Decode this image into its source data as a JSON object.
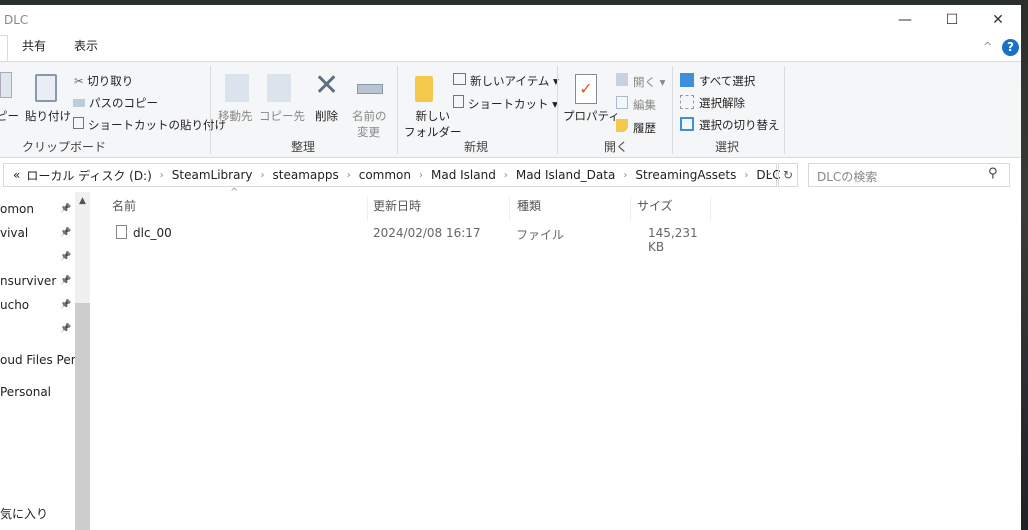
{
  "window": {
    "title": "DLC",
    "minimize": "—",
    "maximize": "☐",
    "close": "✕",
    "help": "?",
    "collapse": "^"
  },
  "tabs": [
    "共有",
    "表示"
  ],
  "ribbon": {
    "clipboard": {
      "copy": "ピー",
      "paste": "貼り付け",
      "cut": "切り取り",
      "copy_path": "パスのコピー",
      "paste_shortcut": "ショートカットの貼り付け",
      "group": "クリップボード"
    },
    "organize": {
      "move_to": "移動先",
      "copy_to": "コピー先",
      "delete": "削除",
      "rename_1": "名前の",
      "rename_2": "変更",
      "group": "整理"
    },
    "new": {
      "new_folder_1": "新しい",
      "new_folder_2": "フォルダー",
      "new_item": "新しいアイテム ▾",
      "shortcut": "ショートカット ▾",
      "group": "新規"
    },
    "open": {
      "properties": "プロパティ",
      "open": "開く ▾",
      "edit": "編集",
      "history": "履歴",
      "group": "開く"
    },
    "select": {
      "select_all": "すべて選択",
      "select_none": "選択解除",
      "invert": "選択の切り替え",
      "group": "選択"
    }
  },
  "address": {
    "overflow": "«",
    "crumbs": [
      "ローカル ディスク (D:)",
      "SteamLibrary",
      "steamapps",
      "common",
      "Mad Island",
      "Mad Island_Data",
      "StreamingAssets",
      "DLC"
    ],
    "sep": "›"
  },
  "search": {
    "placeholder": "DLCの検索"
  },
  "sidebar": {
    "items": [
      "omon",
      "vival",
      "",
      "nsurviver",
      "ucho",
      "",
      "oud Files Perso",
      "Personal",
      "気に入り"
    ]
  },
  "columns": {
    "name": "名前",
    "modified": "更新日時",
    "type": "種類",
    "size": "サイズ"
  },
  "files": [
    {
      "name": "dlc_00",
      "modified": "2024/02/08 16:17",
      "type": "ファイル",
      "size": "145,231 KB"
    }
  ]
}
